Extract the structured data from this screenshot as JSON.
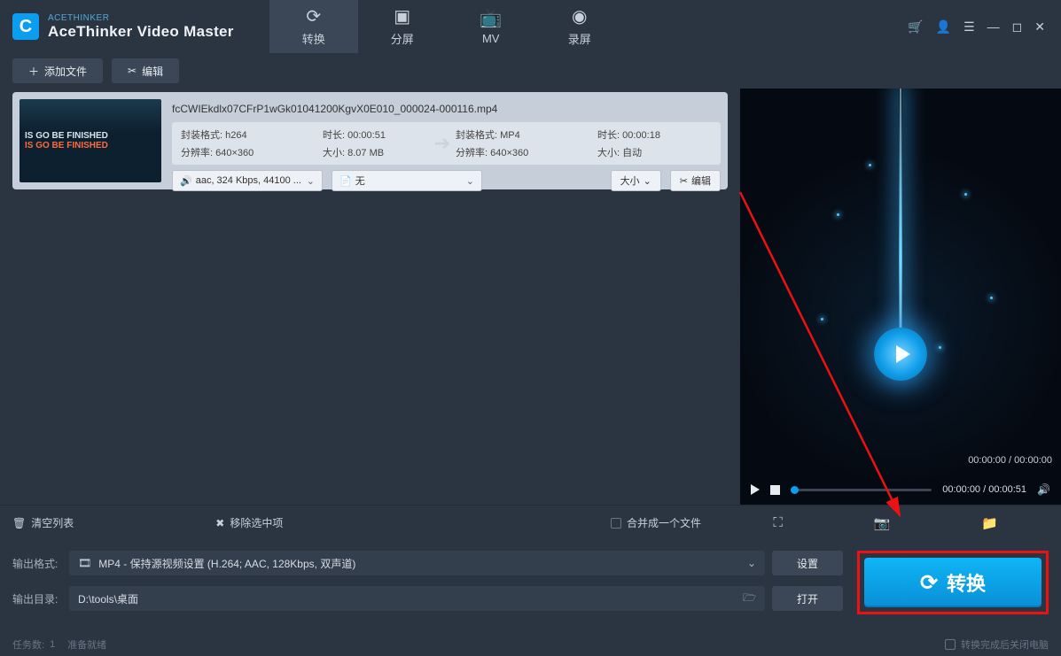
{
  "brand": {
    "small": "ACETHINKER",
    "title": "AceThinker Video Master"
  },
  "tabs": {
    "convert": "转换",
    "split": "分屏",
    "mv": "MV",
    "record": "录屏"
  },
  "toolbar": {
    "add_file": "添加文件",
    "edit": "编辑"
  },
  "file": {
    "name": "fcCWIEkdlx07CFrP1wGk01041200KgvX0E010_000024-000116.mp4",
    "src_format_label": "封装格式:",
    "src_format": "h264",
    "src_duration_label": "时长:",
    "src_duration": "00:00:51",
    "src_res_label": "分辨率:",
    "src_res": "640×360",
    "src_size_label": "大小:",
    "src_size": "8.07 MB",
    "dst_format_label": "封装格式:",
    "dst_format": "MP4",
    "dst_duration_label": "时长:",
    "dst_duration": "00:00:18",
    "dst_res_label": "分辨率:",
    "dst_res": "640×360",
    "dst_size_label": "大小:",
    "dst_size": "自动",
    "audio_dropdown": "aac, 324 Kbps, 44100 ...",
    "subtitle_dropdown": "无",
    "size_btn": "大小",
    "edit_btn": "编辑",
    "thumb_line1": "IS GO BE FINISHED",
    "thumb_line2": "IS GO BE FINISHED"
  },
  "preview": {
    "time_overlay": "00:00:00 / 00:00:00",
    "time_controls": "00:00:00 / 00:00:51"
  },
  "actions": {
    "clear_list": "清空列表",
    "remove_selected": "移除选中项",
    "merge_one": "合并成一个文件"
  },
  "output": {
    "format_label": "输出格式:",
    "format_value": "MP4 - 保持源视频设置 (H.264; AAC, 128Kbps, 双声道)",
    "dir_label": "输出目录:",
    "dir_value": "D:\\tools\\桌面",
    "settings_btn": "设置",
    "open_btn": "打开"
  },
  "convert_btn": "转换",
  "status": {
    "tasks_label": "任务数:",
    "tasks_count": "1",
    "ready": "准备就绪",
    "shutdown_after": "转换完成后关闭电脑"
  }
}
